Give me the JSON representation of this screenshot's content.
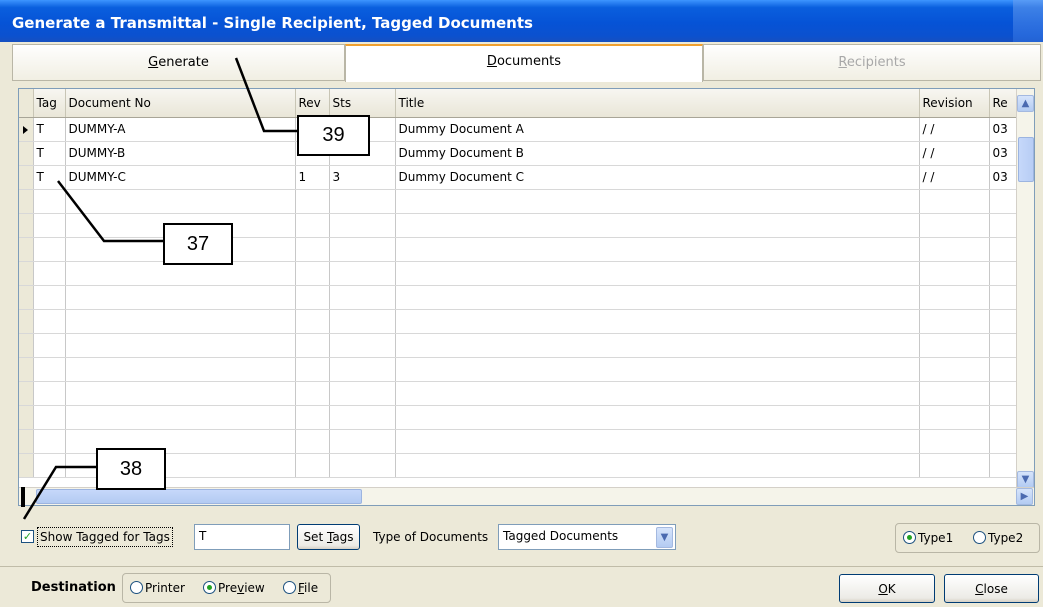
{
  "window": {
    "title": "Generate a Transmittal - Single Recipient, Tagged Documents"
  },
  "tabs": [
    {
      "label": "Generate",
      "accel": "G",
      "rest": "enerate"
    },
    {
      "label": "Documents",
      "accel": "D",
      "rest": "ocuments"
    },
    {
      "label": "Recipients",
      "accel": "R",
      "rest": "ecipients"
    }
  ],
  "grid": {
    "columns": [
      "Tag",
      "Document No",
      "Rev",
      "Sts",
      "Title",
      "Revision",
      "Re"
    ],
    "rows": [
      {
        "tag": "T",
        "doc_no": "DUMMY-A",
        "rev": "",
        "sts": "",
        "title": "Dummy Document A",
        "revision": "/ /",
        "re": "03"
      },
      {
        "tag": "T",
        "doc_no": "DUMMY-B",
        "rev": "",
        "sts": "",
        "title": "Dummy Document B",
        "revision": "/ /",
        "re": "03"
      },
      {
        "tag": "T",
        "doc_no": "DUMMY-C",
        "rev": "1",
        "sts": "3",
        "title": "Dummy Document C",
        "revision": "/ /",
        "re": "03"
      }
    ]
  },
  "filter": {
    "show_tagged_label": "Show Tagged for Tags",
    "show_tagged_checked": true,
    "tags_value": "T",
    "set_tags": {
      "pre": "Set ",
      "accel": "T",
      "post": "ags"
    },
    "type_label": "Type of Documents",
    "type_value": "Tagged Documents"
  },
  "type_radio": {
    "options": [
      "Type1",
      "Type2"
    ],
    "selected": "Type1"
  },
  "destination": {
    "label": "Destination",
    "printer": "Printer",
    "preview": {
      "pre": "Pre",
      "accel": "v",
      "post": "iew"
    },
    "file": {
      "accel": "F",
      "post": "ile"
    },
    "selected": "Preview"
  },
  "buttons": {
    "ok": {
      "accel": "O",
      "post": "K"
    },
    "close": {
      "accel": "C",
      "post": "lose"
    }
  },
  "callouts": {
    "a": "39",
    "b": "37",
    "c": "38"
  }
}
